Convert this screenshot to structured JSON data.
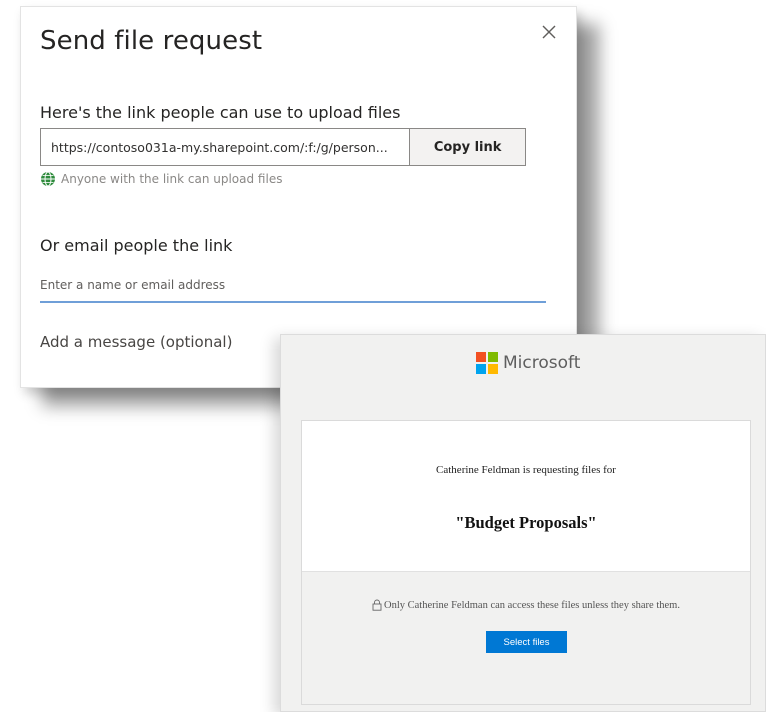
{
  "dialog": {
    "title": "Send file request",
    "link_heading": "Here's the link people can use to upload files",
    "link_value": "https://contoso031a-my.sharepoint.com/:f:/g/person...",
    "copy_label": "Copy link",
    "anyone_text": "Anyone with the link can upload files",
    "email_heading": "Or email people the link",
    "email_placeholder": "Enter a name or email address",
    "message_placeholder": "Add a message (optional)"
  },
  "email": {
    "brand": "Microsoft",
    "requesting_text": "Catherine Feldman is requesting files for",
    "folder_name": "\"Budget Proposals\"",
    "privacy_text": "Only Catherine Feldman can access these files unless they share them.",
    "select_label": "Select files"
  },
  "colors": {
    "accent_blue": "#0078d4",
    "globe_green": "#2e8b3c",
    "logo_red": "#f25022",
    "logo_green": "#7fba00",
    "logo_blue": "#00a4ef",
    "logo_yellow": "#ffb900"
  },
  "icons": {
    "close": "close-icon",
    "globe": "globe-icon",
    "microsoft_logo": "microsoft-logo-icon",
    "lock": "lock-icon"
  }
}
